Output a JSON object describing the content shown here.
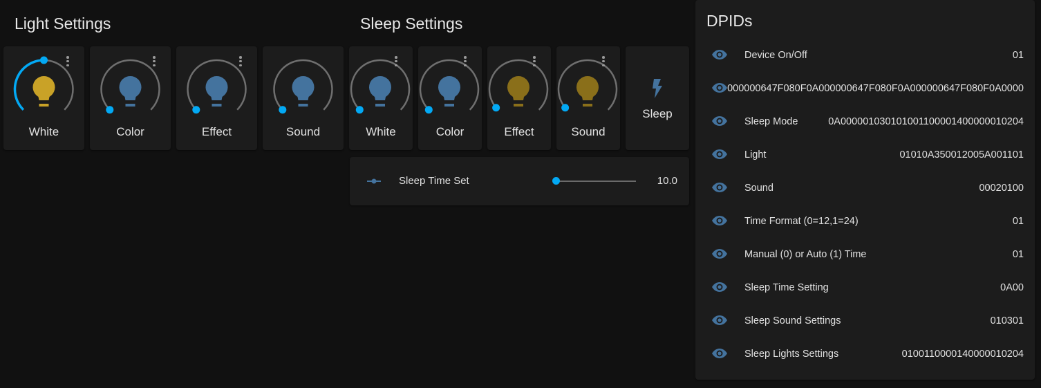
{
  "light_settings": {
    "title": "Light Settings",
    "tiles": [
      {
        "label": "White",
        "icon": "lightbulb-icon",
        "state": "on",
        "level_fraction": 0.5
      },
      {
        "label": "Color",
        "icon": "lightbulb-icon",
        "state": "off",
        "level_fraction": 0.0
      },
      {
        "label": "Effect",
        "icon": "lightbulb-icon",
        "state": "off",
        "level_fraction": 0.0
      },
      {
        "label": "Sound",
        "icon": "lightbulb-icon",
        "state": "off",
        "level_fraction": 0.0
      }
    ]
  },
  "sleep_settings": {
    "title": "Sleep Settings",
    "tiles": [
      {
        "label": "White",
        "icon": "lightbulb-icon",
        "state": "off",
        "level_fraction": 0.0
      },
      {
        "label": "Color",
        "icon": "lightbulb-icon",
        "state": "off",
        "level_fraction": 0.0
      },
      {
        "label": "Effect",
        "icon": "lightbulb-icon",
        "state": "on",
        "level_fraction": 0.02
      },
      {
        "label": "Sound",
        "icon": "lightbulb-icon",
        "state": "on",
        "level_fraction": 0.02
      }
    ],
    "sleep_button": {
      "label": "Sleep",
      "icon": "flash-icon"
    },
    "slider": {
      "label": "Sleep Time Set",
      "value": "10.0",
      "fraction": 0.0,
      "icon": "slider-icon"
    }
  },
  "dpids": {
    "title": "DPIDs",
    "rows": [
      {
        "name": "Device On/Off",
        "value": "01"
      },
      {
        "name": "",
        "value": "000000647F080F0A000000647F080F0A000000647F080F0A0000"
      },
      {
        "name": "Sleep Mode",
        "value": "0A000001030101001100001400000010204"
      },
      {
        "name": "Light",
        "value": "01010A350012005A001101"
      },
      {
        "name": "Sound",
        "value": "00020100"
      },
      {
        "name": "Time Format (0=12,1=24)",
        "value": "01"
      },
      {
        "name": "Manual (0) or Auto (1) Time",
        "value": "01"
      },
      {
        "name": "Sleep Time Setting",
        "value": "0A00"
      },
      {
        "name": "Sleep Sound Settings",
        "value": "010301"
      },
      {
        "name": "Sleep Lights Settings",
        "value": "0100110000140000010204"
      }
    ]
  },
  "colors": {
    "accent": "#03a9f4",
    "bulb_on_light": "#c9a227",
    "bulb_on_sleep": "#8a6f1a",
    "bulb_off": "#44739e",
    "eye_icon": "#44739e",
    "card": "#1c1c1c",
    "background": "#111111"
  }
}
